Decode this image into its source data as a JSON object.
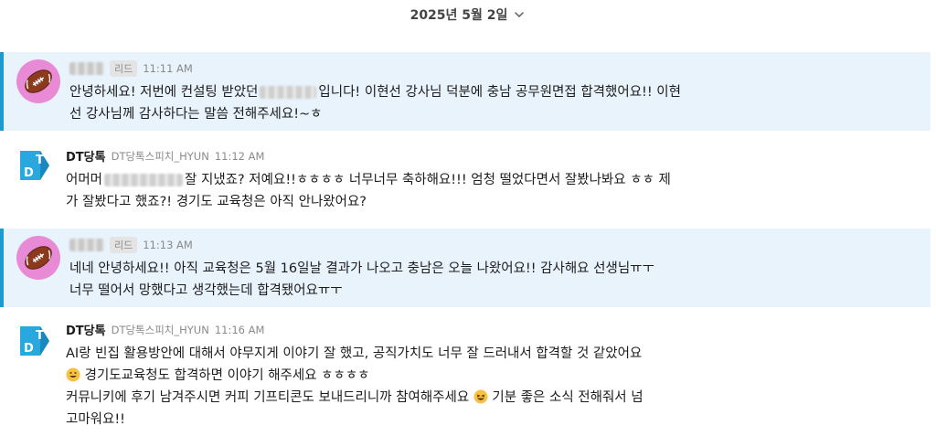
{
  "date_divider": {
    "label": "2025년 5월 2일"
  },
  "messages": [
    {
      "role": "리드",
      "time": "11:11 AM",
      "line1_pre": "안녕하세요! 저번에 컨설팅 받았던",
      "line1_post": "입니다! 이현선 강사님 덕분에 충남 공무원면접 합격했어요!! 이현",
      "line2": "선 강사님께 감사하다는 말씀 전해주세요!~ㅎ"
    },
    {
      "sender": "DT당톡",
      "sub_sender": "DT당톡스피치_HYUN",
      "time": "11:12 AM",
      "line1_pre": "어머머",
      "line1_post": "잘 지냈죠? 저예요!!ㅎㅎㅎㅎ 너무너무 축하해요!!! 엄청 떨었다면서 잘봤나봐요 ㅎㅎ 제",
      "line2": "가 잘봤다고 했죠?! 경기도 교육청은 아직 안나왔어요?"
    },
    {
      "role": "리드",
      "time": "11:13 AM",
      "line1": "네네 안녕하세요!! 아직 교육청은 5월 16일날 결과가 나오고 충남은 오늘 나왔어요!! 감사해요 선생님ㅠㅜ",
      "line2": "너무 떨어서 망했다고 생각했는데 합격됐어요ㅠㅜ"
    },
    {
      "sender": "DT당톡",
      "sub_sender": "DT당톡스피치_HYUN",
      "time": "11:16 AM",
      "line1": "AI랑 빈집 활용방안에 대해서 야무지게 이야기 잘 했고, 공직가치도 너무 잘 드러내서 합격할 것 같았어요",
      "line2": "경기도교육청도 합격하면 이야기 해주세요 ㅎㅎㅎㅎ",
      "line3_pre": "커뮤니키에 후기 남겨주시면 커피 기프티콘도 보내드리니까 참여해주세요",
      "line3_post": "기분 좋은 소식 전해줘서 넘",
      "line4": "고마워요!!"
    }
  ],
  "avatar_letters": [
    "T",
    "D"
  ],
  "icons": {
    "date_chevron": "chevron-down-icon",
    "lead_avatar": "football-icon",
    "dt_avatar": "dt-logo-icon",
    "smile": "grinning-face-icon",
    "laugh": "laughing-face-icon"
  },
  "colors": {
    "highlight_bg": "#e8f3fc",
    "highlight_bar": "#1d9bd1",
    "lead_avatar_bg": "#e88ad5",
    "dt_blue": "#29a8e0"
  }
}
